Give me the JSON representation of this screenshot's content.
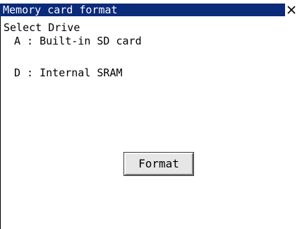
{
  "window": {
    "title": "Memory card format",
    "close_icon": "close-icon"
  },
  "content": {
    "prompt": "Select Drive",
    "drives": [
      {
        "label": "A : Built-in SD card"
      },
      {
        "label": "D : Internal SRAM"
      }
    ],
    "format_button": "Format"
  },
  "colors": {
    "title_bar": "#0a2a7a",
    "title_text": "#ffffff",
    "background": "#ffffff",
    "button_face": "#e6e6e6"
  }
}
